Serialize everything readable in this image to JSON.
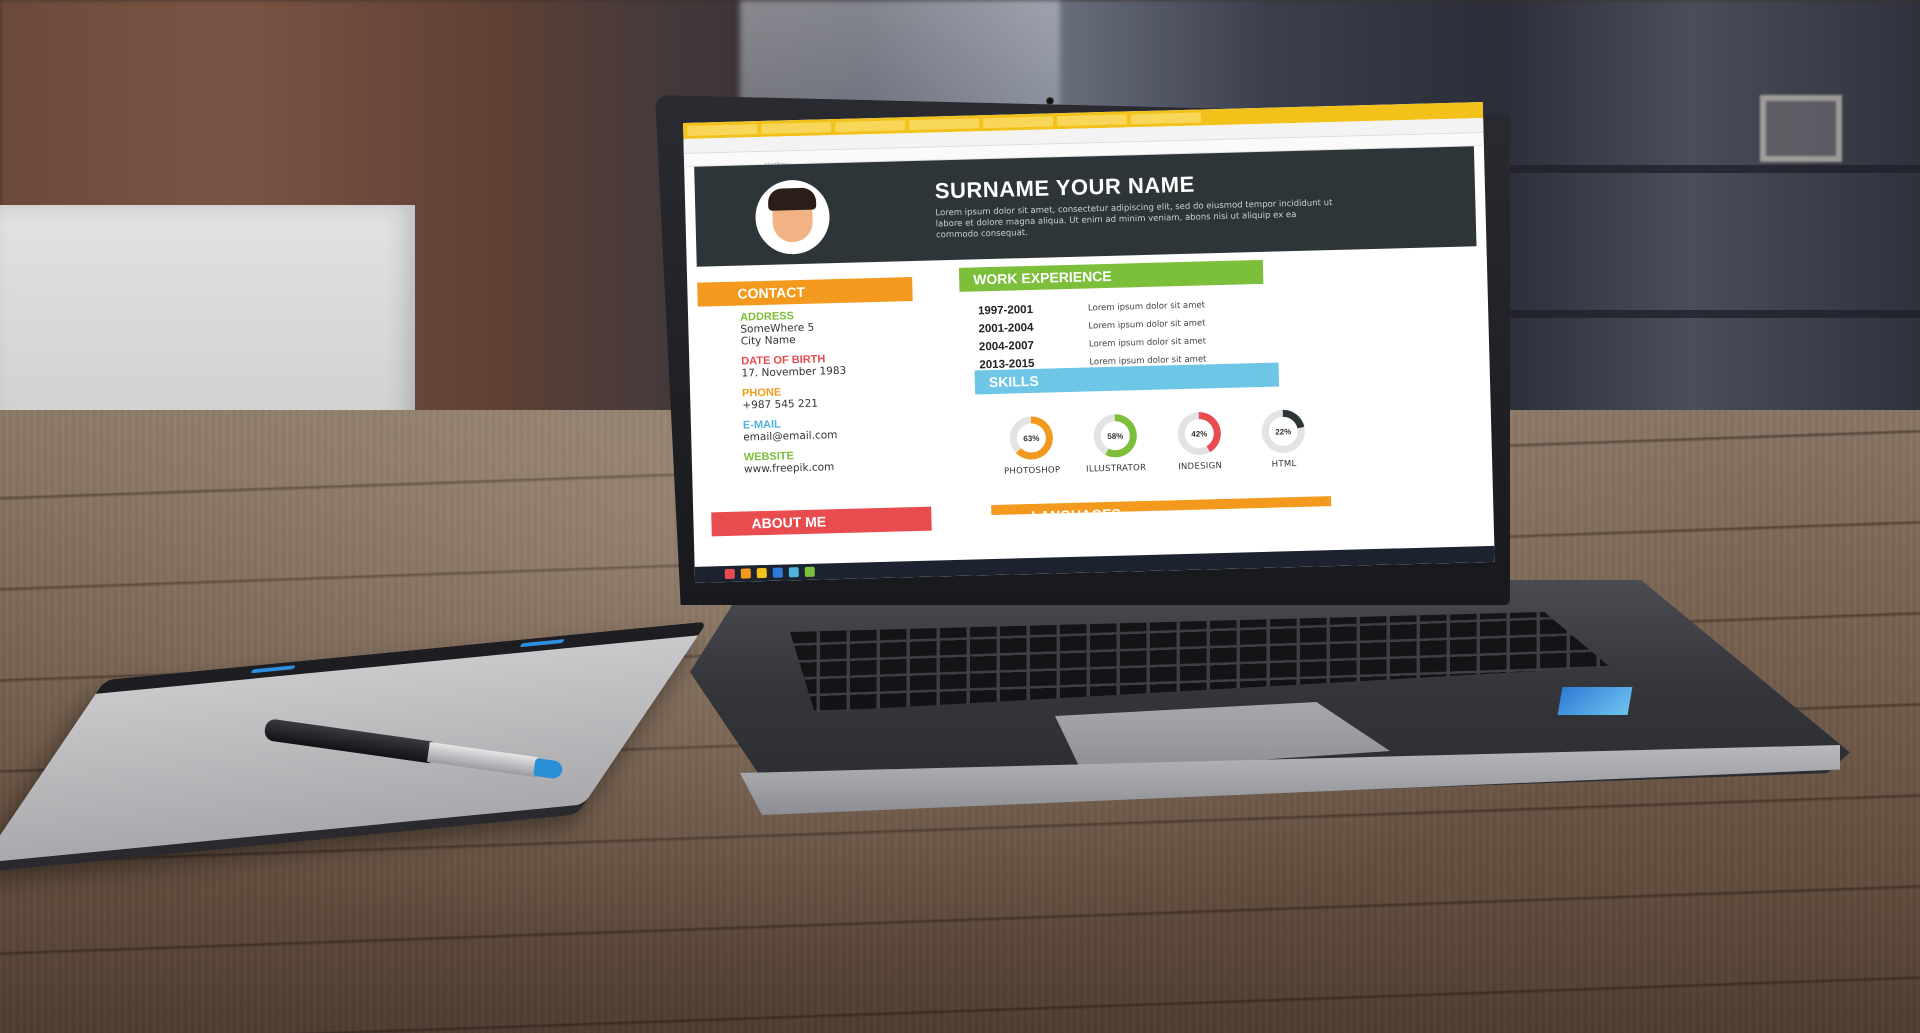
{
  "resume": {
    "name": "SURNAME YOUR NAME",
    "intro": "Lorem ipsum dolor sit amet, consectetur adipiscing elit, sed do eiusmod tempor incididunt ut labore et dolore magna aliqua. Ut enim ad minim veniam, abons nisi ut aliquip ex ea commodo consequat.",
    "sections": {
      "contact": "CONTACT",
      "work": "WORK EXPERIENCE",
      "skills": "SKILLS",
      "about": "ABOUT ME",
      "languages": "LANGUAGES"
    },
    "contact": [
      {
        "label": "ADDRESS",
        "value": "SomeWhere 5\nCity Name",
        "color": "#7cbf3a"
      },
      {
        "label": "DATE OF BIRTH",
        "value": "17. November 1983",
        "color": "#e84c4f"
      },
      {
        "label": "PHONE",
        "value": "+987 545 221",
        "color": "#f39a1e"
      },
      {
        "label": "E-MAIL",
        "value": "email@email.com",
        "color": "#4fb3de"
      },
      {
        "label": "WEBSITE",
        "value": "www.freepik.com",
        "color": "#7cbf3a"
      }
    ],
    "work": [
      {
        "years": "1997-2001",
        "desc": "Lorem ipsum dolor sit amet"
      },
      {
        "years": "2001-2004",
        "desc": "Lorem ipsum dolor sit amet"
      },
      {
        "years": "2004-2007",
        "desc": "Lorem ipsum dolor sit amet"
      },
      {
        "years": "2013-2015",
        "desc": "Lorem ipsum dolor sit amet"
      }
    ],
    "skills": [
      {
        "name": "PHOTOSHOP",
        "percent": "63%",
        "value": 63,
        "color": "#f39a1e"
      },
      {
        "name": "ILLUSTRATOR",
        "percent": "58%",
        "value": 58,
        "color": "#7cbf3a"
      },
      {
        "name": "INDESIGN",
        "percent": "42%",
        "value": 42,
        "color": "#e84c4f"
      },
      {
        "name": "HTML",
        "percent": "22%",
        "value": 22,
        "color": "#2e3539"
      }
    ],
    "browser_url": "pixabay"
  },
  "colors": {
    "header_bg": "#2e3539",
    "contact_bar": "#f39a1e",
    "work_bar": "#7cbf3a",
    "skills_bar": "#6ec6e6",
    "about_bar": "#e84c4f",
    "languages_bar": "#f39a1e"
  }
}
